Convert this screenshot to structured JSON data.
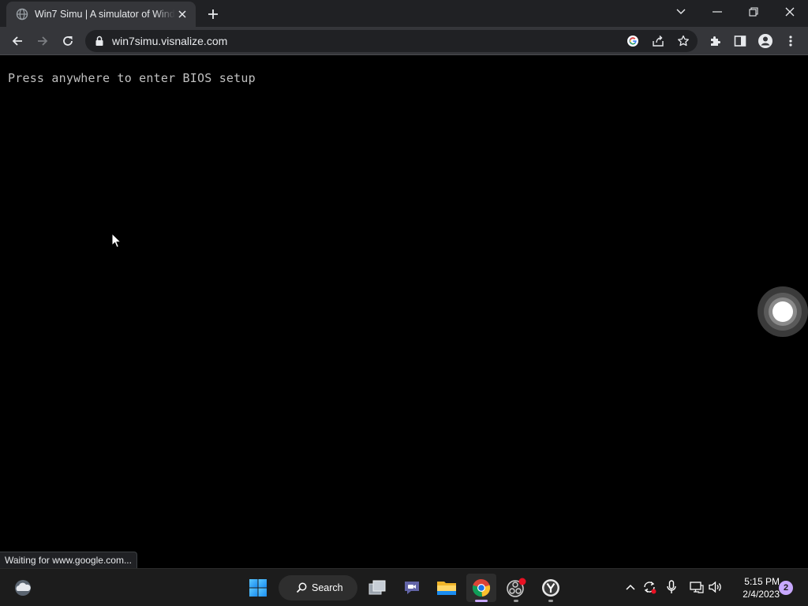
{
  "browser": {
    "tab": {
      "title": "Win7 Simu | A simulator of Windows 7",
      "favicon": "globe-icon"
    },
    "new_tab_icon": "plus-icon",
    "window_controls": [
      "chevron-down-icon",
      "minimize-icon",
      "restore-icon",
      "close-icon"
    ],
    "toolbar": {
      "back_icon": "back-arrow-icon",
      "forward_icon": "forward-arrow-icon",
      "reload_icon": "reload-icon",
      "url": "win7simu.visnalize.com",
      "omnibox_icons": [
        "google-lens-icon",
        "share-icon",
        "bookmark-star-icon"
      ],
      "right_icons": [
        "extensions-icon",
        "side-panel-icon",
        "profile-icon",
        "menu-icon"
      ]
    },
    "status_text": "Waiting for www.google.com..."
  },
  "page": {
    "background": "#000000",
    "text_color": "#c0c0c0",
    "bios_prompt": "Press anywhere to enter BIOS setup"
  },
  "taskbar": {
    "weather_icon": "weather-cloud-icon",
    "start_icon": "windows-start-icon",
    "search_label": "Search",
    "apps": [
      {
        "name": "task-view-icon"
      },
      {
        "name": "teams-chat-icon"
      },
      {
        "name": "file-explorer-icon"
      },
      {
        "name": "chrome-icon",
        "active": true,
        "indicator_color": "#c8a8ff"
      },
      {
        "name": "obs-icon",
        "badge": true
      },
      {
        "name": "yandex-browser-icon"
      }
    ],
    "tray_icons": [
      "chevron-up-icon",
      "sync-icon",
      "microphone-icon",
      "network-icon",
      "volume-icon"
    ],
    "clock": {
      "time": "5:15 PM",
      "date": "2/4/2023"
    },
    "notification_count": "2",
    "accent": "#c8a8ff"
  }
}
